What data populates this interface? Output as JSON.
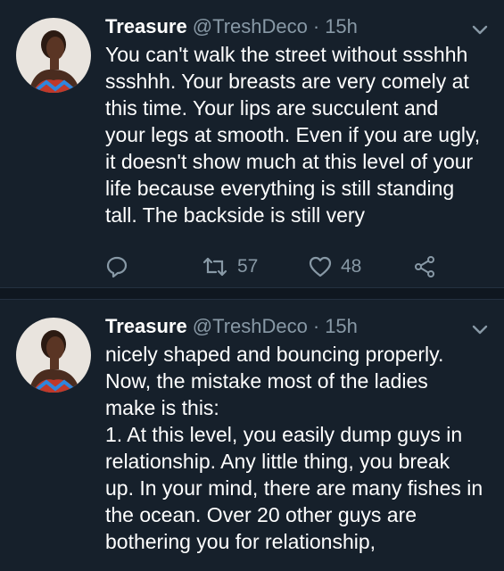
{
  "tweets": [
    {
      "name": "Treasure",
      "handle": "@TreshDeco",
      "separator": "·",
      "time": "15h",
      "text": "You can't walk the street without ssshhh\nssshhh. Your breasts are very comely at\nthis time. Your lips are succulent and\nyour legs at smooth. Even if you are ugly,\nit doesn't show much at this level of your\nlife because everything is still standing\ntall. The backside is still very",
      "retweets": "57",
      "likes": "48",
      "icons": [
        "reply-icon",
        "retweet-icon",
        "like-icon",
        "share-icon",
        "chevron-down-icon"
      ]
    },
    {
      "name": "Treasure",
      "handle": "@TreshDeco",
      "separator": "·",
      "time": "15h",
      "text": "nicely shaped and bouncing properly.\nNow, the mistake most of the ladies\nmake is this:\n1. At this level, you easily dump guys in\nrelationship. Any little thing, you break\nup. In your mind, there are many fishes in\nthe ocean. Over 20 other guys are\nbothering you for relationship,",
      "icons": [
        "chevron-down-icon"
      ]
    }
  ],
  "colors": {
    "background": "#16202b",
    "secondary_text": "#8899a6",
    "primary_text": "#ffffff"
  }
}
